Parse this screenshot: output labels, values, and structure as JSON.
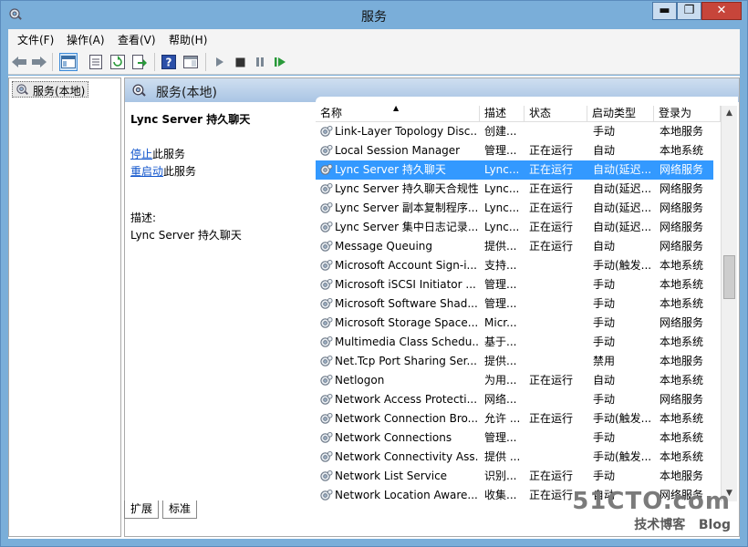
{
  "window": {
    "title": "服务",
    "minimize": "▬",
    "maximize": "❐",
    "close": "✕"
  },
  "menu": [
    {
      "label": "文件(F)"
    },
    {
      "label": "操作(A)"
    },
    {
      "label": "查看(V)"
    },
    {
      "label": "帮助(H)"
    }
  ],
  "tree": {
    "root_label": "服务(本地)"
  },
  "panel": {
    "title": "服务(本地)",
    "service_name": "Lync Server 持久聊天",
    "stop_link": "停止",
    "stop_suffix": "此服务",
    "restart_link": "重启动",
    "restart_suffix": "此服务",
    "desc_label": "描述:",
    "desc_text": "Lync Server 持久聊天"
  },
  "columns": {
    "name": "名称",
    "desc": "描述",
    "status": "状态",
    "startup": "启动类型",
    "logon": "登录为",
    "sort_arrow": "▲"
  },
  "services": [
    {
      "name": "Link-Layer Topology Disc...",
      "desc": "创建...",
      "status": "",
      "startup": "手动",
      "logon": "本地服务"
    },
    {
      "name": "Local Session Manager",
      "desc": "管理...",
      "status": "正在运行",
      "startup": "自动",
      "logon": "本地系统"
    },
    {
      "name": "Lync Server 持久聊天",
      "desc": "Lync...",
      "status": "正在运行",
      "startup": "自动(延迟...",
      "logon": "网络服务"
    },
    {
      "name": "Lync Server 持久聊天合规性",
      "desc": "Lync...",
      "status": "正在运行",
      "startup": "自动(延迟...",
      "logon": "网络服务"
    },
    {
      "name": "Lync Server 副本复制程序...",
      "desc": "Lync...",
      "status": "正在运行",
      "startup": "自动(延迟...",
      "logon": "网络服务"
    },
    {
      "name": "Lync Server 集中日志记录...",
      "desc": "Lync...",
      "status": "正在运行",
      "startup": "自动(延迟...",
      "logon": "网络服务"
    },
    {
      "name": "Message Queuing",
      "desc": "提供...",
      "status": "正在运行",
      "startup": "自动",
      "logon": "网络服务"
    },
    {
      "name": "Microsoft Account Sign-i...",
      "desc": "支持...",
      "status": "",
      "startup": "手动(触发...",
      "logon": "本地系统"
    },
    {
      "name": "Microsoft iSCSI Initiator ...",
      "desc": "管理...",
      "status": "",
      "startup": "手动",
      "logon": "本地系统"
    },
    {
      "name": "Microsoft Software Shad...",
      "desc": "管理...",
      "status": "",
      "startup": "手动",
      "logon": "本地系统"
    },
    {
      "name": "Microsoft Storage Space...",
      "desc": "Micr...",
      "status": "",
      "startup": "手动",
      "logon": "网络服务"
    },
    {
      "name": "Multimedia Class Schedu...",
      "desc": "基于...",
      "status": "",
      "startup": "手动",
      "logon": "本地系统"
    },
    {
      "name": "Net.Tcp Port Sharing Ser...",
      "desc": "提供...",
      "status": "",
      "startup": "禁用",
      "logon": "本地服务"
    },
    {
      "name": "Netlogon",
      "desc": "为用...",
      "status": "正在运行",
      "startup": "自动",
      "logon": "本地系统"
    },
    {
      "name": "Network Access Protecti...",
      "desc": "网络...",
      "status": "",
      "startup": "手动",
      "logon": "网络服务"
    },
    {
      "name": "Network Connection Bro...",
      "desc": "允许 ...",
      "status": "正在运行",
      "startup": "手动(触发...",
      "logon": "本地系统"
    },
    {
      "name": "Network Connections",
      "desc": "管理...",
      "status": "",
      "startup": "手动",
      "logon": "本地系统"
    },
    {
      "name": "Network Connectivity Ass...",
      "desc": "提供 ...",
      "status": "",
      "startup": "手动(触发...",
      "logon": "本地系统"
    },
    {
      "name": "Network List Service",
      "desc": "识别...",
      "status": "正在运行",
      "startup": "手动",
      "logon": "本地服务"
    },
    {
      "name": "Network Location Aware...",
      "desc": "收集...",
      "status": "正在运行",
      "startup": "自动",
      "logon": "网络服务"
    }
  ],
  "selected_index": 2,
  "tabs": [
    {
      "label": "扩展"
    },
    {
      "label": "标准"
    }
  ],
  "watermark": {
    "brand": "51CTO.com",
    "sub": "技术博客",
    "blog": "Blog"
  },
  "colors": {
    "selection": "#3399ff",
    "titlebar": "#7aaed9",
    "link": "#1155cc"
  }
}
